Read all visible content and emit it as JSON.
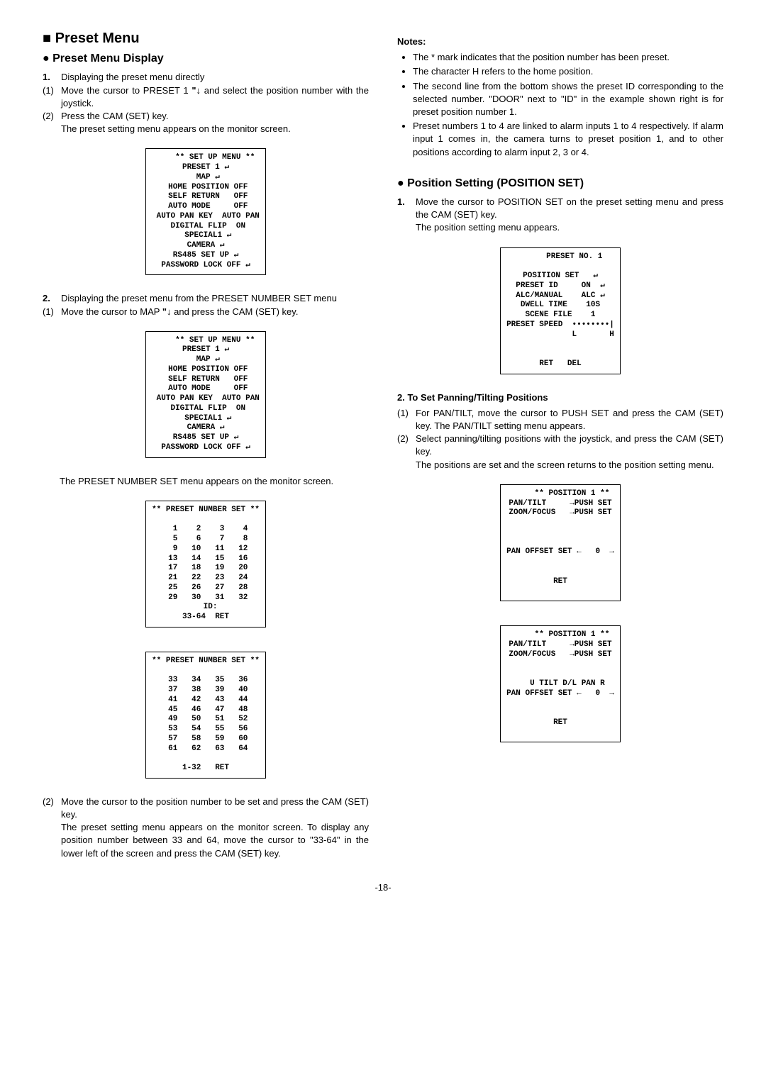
{
  "left": {
    "title_square": "■",
    "title": "Preset Menu",
    "sub_bullet": "●",
    "sub_title": "Preset Menu Display",
    "step1_num": "1.",
    "step1_text": "Displaying the preset menu directly",
    "s1a_num": "(1)",
    "s1a_text_a": "Move the cursor to PRESET 1 ",
    "s1a_icon": "\"↓",
    "s1a_text_b": " and select the position number with the joystick.",
    "s1b_num": "(2)",
    "s1b_text_a": "Press the CAM (SET) key.",
    "s1b_text_b": "The preset setting menu appears on the monitor screen.",
    "screen1": "    ** SET UP MENU **\nPRESET 1 ↵\n MAP ↵\n HOME POSITION OFF\n SELF RETURN   OFF\n AUTO MODE     OFF\n AUTO PAN KEY  AUTO PAN\n DIGITAL FLIP  ON\n SPECIAL1 ↵\nCAMERA ↵\nRS485 SET UP ↵\nPASSWORD LOCK OFF ↵",
    "step2_num": "2.",
    "step2_text": "Displaying the preset menu from the PRESET NUMBER SET menu",
    "s2a_num": "(1)",
    "s2a_text_a": "Move the cursor to MAP ",
    "s2a_icon": "\"↓",
    "s2a_text_b": " and press the CAM (SET) key.",
    "screen2": "    ** SET UP MENU **\nPRESET 1 ↵\n MAP ↵\n HOME POSITION OFF\n SELF RETURN   OFF\n AUTO MODE     OFF\n AUTO PAN KEY  AUTO PAN\n DIGITAL FLIP  ON\n SPECIAL1 ↵\nCAMERA ↵\nRS485 SET UP ↵\nPASSWORD LOCK OFF ↵",
    "after2": "The PRESET NUMBER SET menu appears on the monitor screen.",
    "screen3": "** PRESET NUMBER SET **\n\n  1    2    3    4\n  5    6    7    8\n  9   10   11   12\n 13   14   15   16\n 17   18   19   20\n 21   22   23   24\n 25   26   27   28\n 29   30   31   32\n  ID:\n33-64  RET",
    "screen4": "** PRESET NUMBER SET **\n\n 33   34   35   36\n 37   38   39   40\n 41   42   43   44\n 45   46   47   48\n 49   50   51   52\n 53   54   55   56\n 57   58   59   60\n 61   62   63   64\n\n1-32   RET",
    "s2b_num": "(2)",
    "s2b_text_a": "Move the cursor to the position number to be set and press the CAM (SET) key.",
    "s2b_text_b": "The preset setting menu appears on the monitor screen. To display any position number between 33 and 64, move the cursor to \"33-64\" in the lower left of the screen and press the CAM (SET) key."
  },
  "right": {
    "notes_title": "Notes:",
    "notes": [
      "The * mark indicates that the position number has been preset.",
      "The character H refers to the home position.",
      "The second line from the bottom shows the preset ID corresponding to the selected number. \"DOOR\" next to \"ID\" in the example shown right is for preset position number 1.",
      "Preset numbers 1 to 4 are linked to alarm inputs 1 to 4 respectively. If alarm input 1 comes in, the camera turns to preset position 1, and to other positions according to alarm input 2, 3 or 4."
    ],
    "pos_bullet": "●",
    "pos_title": "Position Setting (POSITION SET)",
    "p1_num": "1.",
    "p1_text_a": "Move the cursor to POSITION SET on the preset setting menu and press the CAM (SET) key.",
    "p1_text_b": "The position setting menu appears.",
    "screen5": "      PRESET NO. 1\n\nPOSITION SET   ↵\nPRESET ID     ON  ↵\nALC/MANUAL    ALC ↵\nDWELL TIME    10S\nSCENE FILE    1\nPRESET SPEED  ••••••••|\n              L       H\n\n\nRET   DEL",
    "p2_title": "2.  To Set Panning/Tilting Positions",
    "p2a_num": "(1)",
    "p2a_text": "For PAN/TILT, move the cursor to PUSH SET and press the CAM (SET) key. The PAN/TILT setting menu appears.",
    "p2b_num": "(2)",
    "p2b_text_a": "Select panning/tilting positions with the joystick, and press the CAM (SET) key.",
    "p2b_text_b": "The positions are set and the screen returns to the position setting menu.",
    "screen6": "     ** POSITION 1 **\nPAN/TILT     →PUSH SET\nZOOM/FOCUS   →PUSH SET\n\n\n\nPAN OFFSET SET ←   0  →\n\n\nRET\n\n",
    "screen7": "     ** POSITION 1 **\nPAN/TILT     →PUSH SET\nZOOM/FOCUS   →PUSH SET\n\n\n   U TILT D/L PAN R\nPAN OFFSET SET ←   0  →\n\n\nRET\n\n"
  },
  "page_number": "-18-"
}
